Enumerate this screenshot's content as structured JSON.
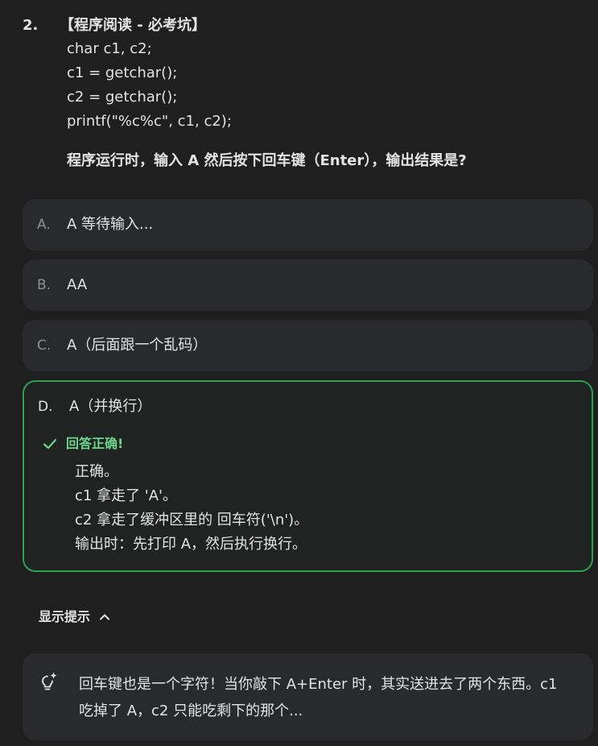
{
  "question": {
    "number": "2.",
    "title": "【程序阅读 - 必考坑】",
    "code": [
      "char c1, c2;",
      "c1 = getchar();",
      "c2 = getchar();",
      "printf(\"%c%c\", c1, c2);"
    ],
    "prompt": "程序运行时，输入 A 然后按下回车键（Enter），输出结果是?"
  },
  "options": [
    {
      "letter": "A.",
      "text": "A 等待输入..."
    },
    {
      "letter": "B.",
      "text": "AA"
    },
    {
      "letter": "C.",
      "text": "A（后面跟一个乱码）"
    },
    {
      "letter": "D.",
      "text": "A（并换行）"
    }
  ],
  "feedback": {
    "label": "回答正确!",
    "lines": [
      "正确。",
      "c1 拿走了 'A'。",
      "c2 拿走了缓冲区里的 回车符('\\n')。",
      "输出时：先打印 A，然后执行换行。"
    ]
  },
  "hint": {
    "toggle_label": "显示提示",
    "text": "回车键也是一个字符！当你敲下 A+Enter 时，其实送进去了两个东西。c1 吃掉了 A，c2 只能吃剩下的那个..."
  },
  "colors": {
    "background": "#1f1f1f",
    "card": "#282a2c",
    "correct_border": "#2ea04f",
    "correct_text": "#6dd58c"
  },
  "icons": {
    "check": "check-icon",
    "chevron": "chevron-up-icon",
    "hint": "lightbulb-sparkle-icon"
  }
}
